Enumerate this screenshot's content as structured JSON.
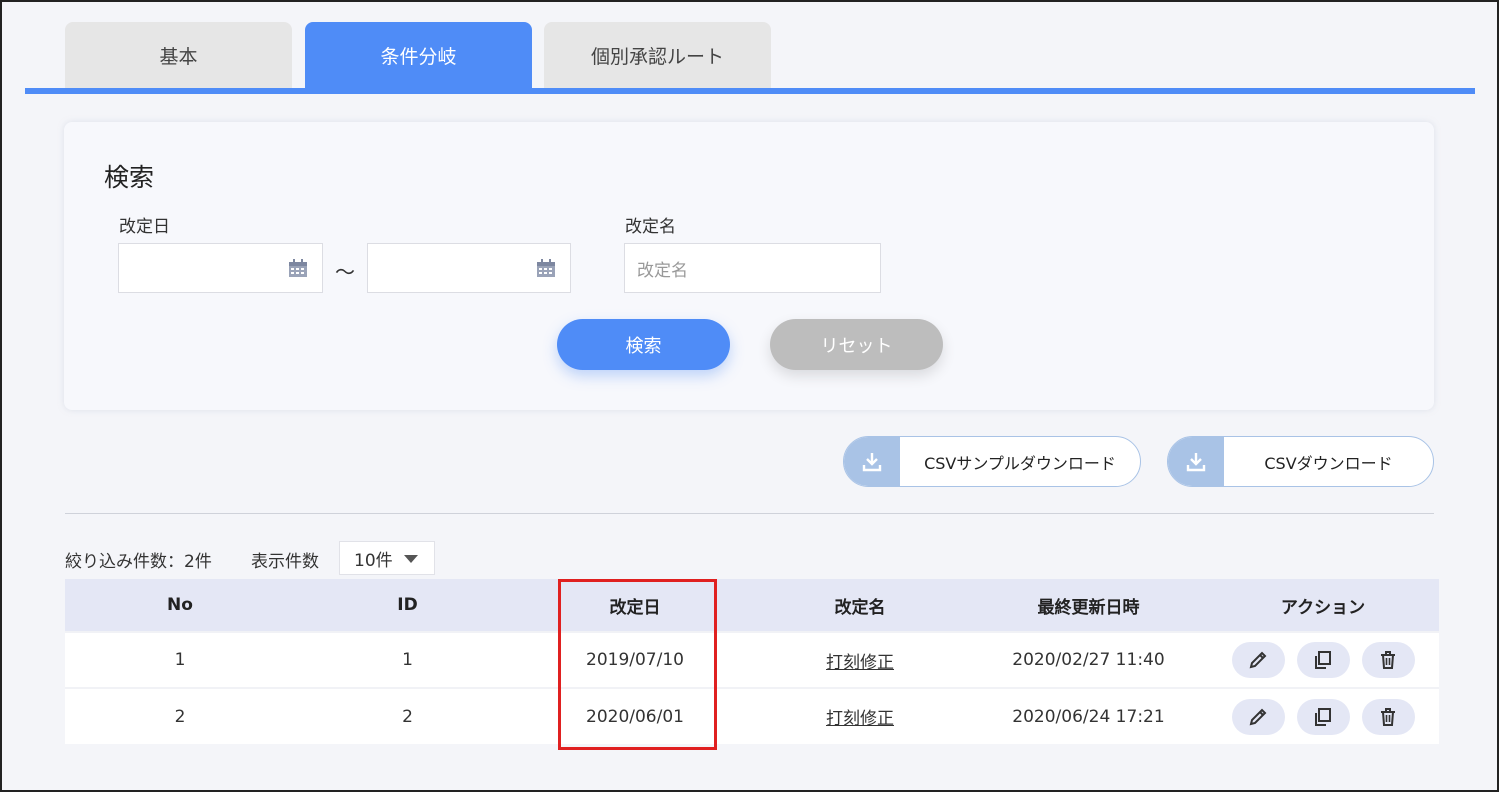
{
  "tabs": [
    {
      "label": "基本"
    },
    {
      "label": "条件分岐"
    },
    {
      "label": "個別承認ルート"
    }
  ],
  "search": {
    "title": "検索",
    "date_label": "改定日",
    "date_separator": "～",
    "name_label": "改定名",
    "name_placeholder": "改定名",
    "search_button": "検索",
    "reset_button": "リセット"
  },
  "csv": {
    "sample_download": "CSVサンプルダウンロード",
    "download": "CSVダウンロード"
  },
  "list": {
    "count_text": "絞り込み件数：2件",
    "perpage_label": "表示件数",
    "perpage_value": "10件"
  },
  "table": {
    "headers": [
      "No",
      "ID",
      "改定日",
      "改定名",
      "最終更新日時",
      "アクション"
    ],
    "rows": [
      {
        "no": "1",
        "id": "1",
        "date": "2019/07/10",
        "name": "打刻修正",
        "updated": "2020/02/27 11:40"
      },
      {
        "no": "2",
        "id": "2",
        "date": "2020/06/01",
        "name": "打刻修正",
        "updated": "2020/06/24 17:21"
      }
    ]
  },
  "colors": {
    "accent": "#4f8cf7",
    "highlight": "#e02020"
  }
}
